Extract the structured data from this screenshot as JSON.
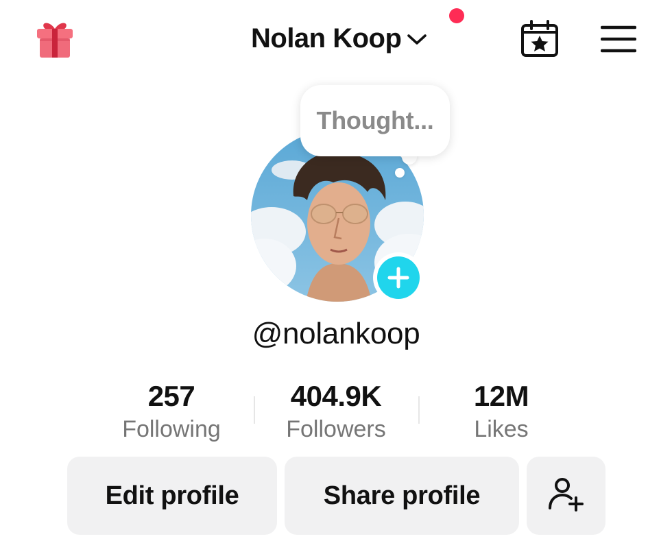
{
  "header": {
    "username": "Nolan Koop",
    "icons": {
      "left": "gift-icon",
      "dropdown": "chevron-down-icon",
      "calendar": "calendar-star-icon",
      "menu": "hamburger-menu-icon"
    },
    "notification_dot_color": "#fe2c55"
  },
  "profile": {
    "thought_placeholder": "Thought...",
    "handle": "@nolankoop",
    "add_button_color": "#20d5ec"
  },
  "stats": [
    {
      "value": "257",
      "label": "Following"
    },
    {
      "value": "404.9K",
      "label": "Followers"
    },
    {
      "value": "12M",
      "label": "Likes"
    }
  ],
  "actions": {
    "edit_profile": "Edit profile",
    "share_profile": "Share profile",
    "add_friend_icon": "add-friend-icon"
  }
}
